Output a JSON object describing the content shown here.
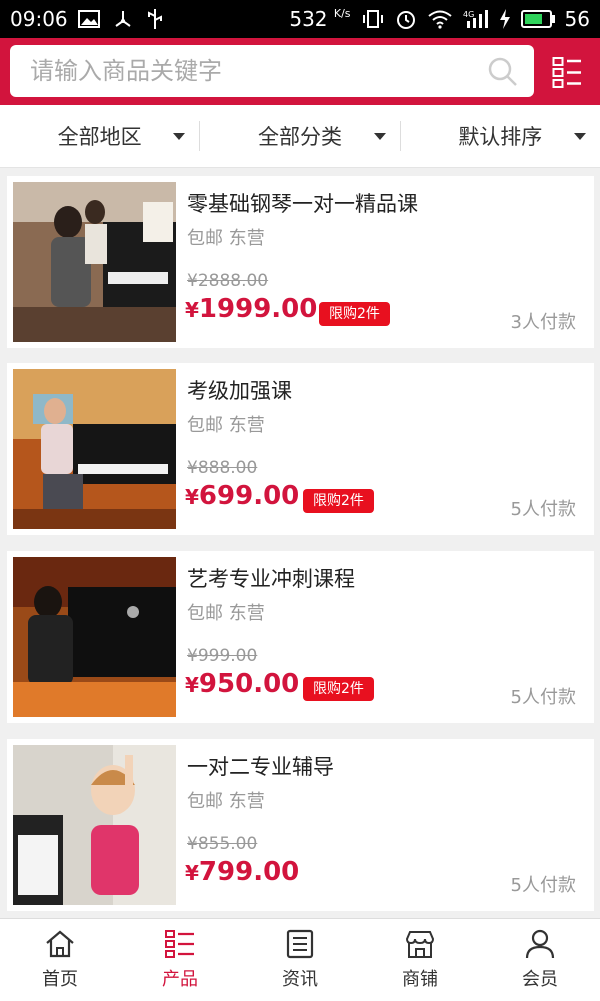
{
  "status_bar": {
    "time": "09:06",
    "speed": "532",
    "speed_unit": "K/s",
    "battery": "56"
  },
  "search": {
    "placeholder": "请输入商品关键字"
  },
  "filters": {
    "region": "全部地区",
    "category": "全部分类",
    "sort": "默认排序"
  },
  "products": [
    {
      "title": "零基础钢琴一对一精品课",
      "location": "包邮 东营",
      "old_price": "¥2888.00",
      "price": "1999.00",
      "badge": "限购2件",
      "paid": "3人付款"
    },
    {
      "title": "考级加强课",
      "location": "包邮 东营",
      "old_price": "¥888.00",
      "price": "699.00",
      "badge": "限购2件",
      "paid": "5人付款"
    },
    {
      "title": "艺考专业冲刺课程",
      "location": "包邮 东营",
      "old_price": "¥999.00",
      "price": "950.00",
      "badge": "限购2件",
      "paid": "5人付款"
    },
    {
      "title": "一对二专业辅导",
      "location": "包邮 东营",
      "old_price": "¥855.00",
      "price": "799.00",
      "paid": "5人付款"
    }
  ],
  "currency_symbol": "¥",
  "tabs": [
    {
      "label": "首页",
      "icon": "home-icon"
    },
    {
      "label": "产品",
      "icon": "grid-list-icon",
      "active": true
    },
    {
      "label": "资讯",
      "icon": "news-icon"
    },
    {
      "label": "商铺",
      "icon": "shop-icon"
    },
    {
      "label": "会员",
      "icon": "user-icon"
    }
  ],
  "colors": {
    "brand": "#d2143d",
    "badge": "#e8101f"
  }
}
